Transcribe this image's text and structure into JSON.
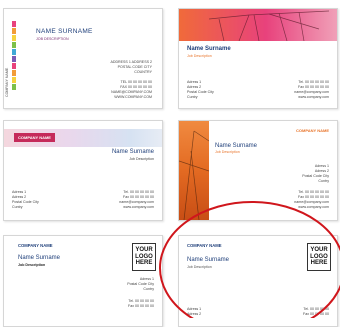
{
  "card1": {
    "name": "NAME SURNAME",
    "job": "JOB DESCRIPTION",
    "address": [
      "ADDRESS 1 ADDRESS 2",
      "POSTAL CODE CITY",
      "COUNTRY"
    ],
    "contact": [
      "TEL 00 00 00 00 00",
      "FAX 00 00 00 00 00",
      "NAME@COMPANY.COM",
      "WWW.COMPANY.COM"
    ],
    "vertical": "COMPANY NAME",
    "stripe_colors": [
      "#e8427c",
      "#f29c38",
      "#f7d23e",
      "#7cc04a",
      "#3fa9d6",
      "#7a5bb5",
      "#e8427c",
      "#f29c38",
      "#f7d23e",
      "#7cc04a"
    ]
  },
  "card2": {
    "name": "Name Surname",
    "job": "Job Description",
    "address": [
      "Adress 1",
      "Adress 2",
      "Postal Code City",
      "Cuntry"
    ],
    "contact": [
      "Tel. 00 00 00 00 00",
      "Fax 00 00 00 00 00",
      "name@company.com",
      "www.company.com"
    ]
  },
  "card3": {
    "company": "COMPANY NAME",
    "name": "Name Surname",
    "job": "Job Description",
    "address": [
      "Adress 1",
      "Adress 2",
      "Postal Code City",
      "Cuntry"
    ],
    "contact": [
      "Tel. 00 00 00 00 00",
      "Fax 00 00 00 00 00",
      "name@company.com",
      "www.company.com"
    ]
  },
  "card4": {
    "company": "COMPANY NAME",
    "name": "Name Surname",
    "job": "Job Description",
    "address": [
      "Adress 1",
      "Adress 2",
      "Postal Code City",
      "Cuntry"
    ],
    "contact": [
      "Tel. 00 00 00 00 00",
      "Fax 00 00 00 00 00",
      "name@company.com",
      "www.company.com"
    ]
  },
  "card5": {
    "company": "COMPANY NAME",
    "name": "Name Surname",
    "job": "Job Description",
    "logo": [
      "YOUR",
      "LOGO",
      "HERE"
    ],
    "address": [
      "Adress 1",
      "Postal Code City",
      "Cuntry"
    ],
    "contact": [
      "Tel. 00 00 00 00",
      "Fax 00 00 00 00"
    ]
  },
  "card6": {
    "company": "COMPANY NAME",
    "name": "Name Surname",
    "job": "Job Description",
    "logo": [
      "YOUR",
      "LOGO",
      "HERE"
    ],
    "address": [
      "Adress 1",
      "Adress 2"
    ],
    "contact": [
      "Tel. 00 00 00 00",
      "Fax 00 00 00 00"
    ]
  },
  "colors": {
    "orange": "#e8742a",
    "red_circle": "#d0161c",
    "blue_name": "#1f3f7a",
    "purple": "#7a2a6e"
  }
}
